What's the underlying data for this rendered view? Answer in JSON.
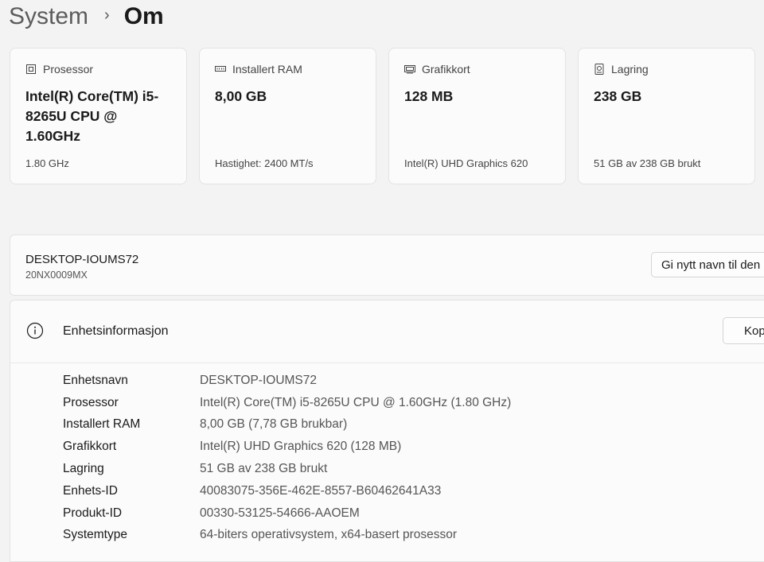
{
  "breadcrumb": {
    "parent": "System",
    "separator": "›",
    "current": "Om"
  },
  "cards": [
    {
      "icon": "processor-icon",
      "label": "Prosessor",
      "value": "Intel(R) Core(TM) i5-8265U CPU @ 1.60GHz",
      "sub": "1.80 GHz"
    },
    {
      "icon": "ram-icon",
      "label": "Installert RAM",
      "value": "8,00 GB",
      "sub": "Hastighet: 2400 MT/s"
    },
    {
      "icon": "graphics-card-icon",
      "label": "Grafikkort",
      "value": "128 MB",
      "sub": "Intel(R) UHD Graphics 620"
    },
    {
      "icon": "storage-icon",
      "label": "Lagring",
      "value": "238 GB",
      "sub": "51 GB av 238 GB brukt"
    }
  ],
  "device": {
    "name": "DESKTOP-IOUMS72",
    "model": "20NX0009MX",
    "rename_label": "Gi nytt navn til den"
  },
  "device_info": {
    "title": "Enhetsinformasjon",
    "copy_label": "Kopier",
    "rows": [
      {
        "label": "Enhetsnavn",
        "value": "DESKTOP-IOUMS72"
      },
      {
        "label": "Prosessor",
        "value": "Intel(R) Core(TM) i5-8265U CPU @ 1.60GHz   (1.80 GHz)"
      },
      {
        "label": "Installert RAM",
        "value": "8,00 GB (7,78 GB brukbar)"
      },
      {
        "label": "Grafikkort",
        "value": "Intel(R) UHD Graphics 620 (128 MB)"
      },
      {
        "label": "Lagring",
        "value": "51 GB av 238 GB brukt"
      },
      {
        "label": "Enhets-ID",
        "value": "40083075-356E-462E-8557-B60462641A33"
      },
      {
        "label": "Produkt-ID",
        "value": "00330-53125-54666-AAOEM"
      },
      {
        "label": "Systemtype",
        "value": "64-biters operativsystem, x64-basert prosessor"
      }
    ]
  }
}
